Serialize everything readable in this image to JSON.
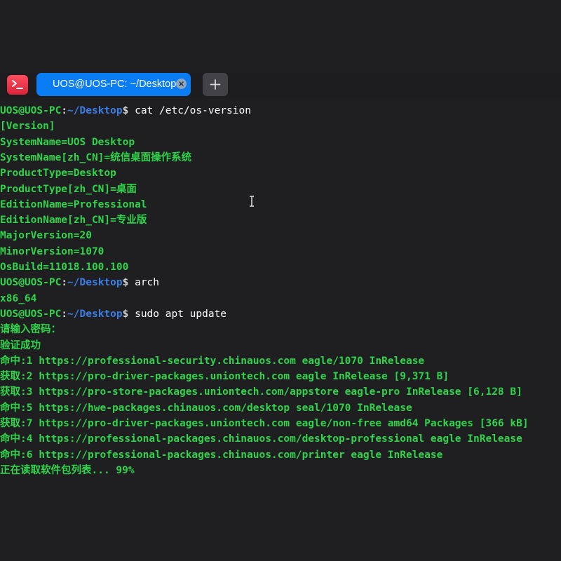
{
  "window": {
    "tab_title": "UOS@UOS-PC: ~/Desktop"
  },
  "prompt": {
    "user_host": "UOS@UOS-PC",
    "colon": ":",
    "path": "~/Desktop",
    "dollar": "$ "
  },
  "commands": [
    "cat /etc/os-version",
    "arch",
    "sudo apt update"
  ],
  "output1": [
    "[Version]",
    "SystemName=UOS Desktop",
    "SystemName[zh_CN]=统信桌面操作系统",
    "ProductType=Desktop",
    "ProductType[zh_CN]=桌面",
    "EditionName=Professional",
    "EditionName[zh_CN]=专业版",
    "MajorVersion=20",
    "MinorVersion=1070",
    "OsBuild=11018.100.100"
  ],
  "output2": [
    "x86_64"
  ],
  "output3": [
    "请输入密码：",
    "验证成功",
    "命中:1 https://professional-security.chinauos.com eagle/1070 InRelease",
    "获取:2 https://pro-driver-packages.uniontech.com eagle InRelease [9,371 B]",
    "获取:3 https://pro-store-packages.uniontech.com/appstore eagle-pro InRelease [6,128 B]",
    "命中:5 https://hwe-packages.chinauos.com/desktop seal/1070 InRelease",
    "获取:7 https://pro-driver-packages.uniontech.com eagle/non-free amd64 Packages [366 kB]",
    "命中:4 https://professional-packages.chinauos.com/desktop-professional eagle InRelease",
    "命中:6 https://professional-packages.chinauos.com/printer eagle InRelease",
    "正在读取软件包列表... 99%"
  ],
  "icons": {
    "app": "terminal-icon",
    "close": "close-icon",
    "add": "plus-icon",
    "cursor": "text-cursor-icon"
  },
  "colors": {
    "background": "#1f1f21",
    "tab_active": "#0a7cf4",
    "text_green": "#2fd44a",
    "path_blue": "#3a7ee8"
  }
}
